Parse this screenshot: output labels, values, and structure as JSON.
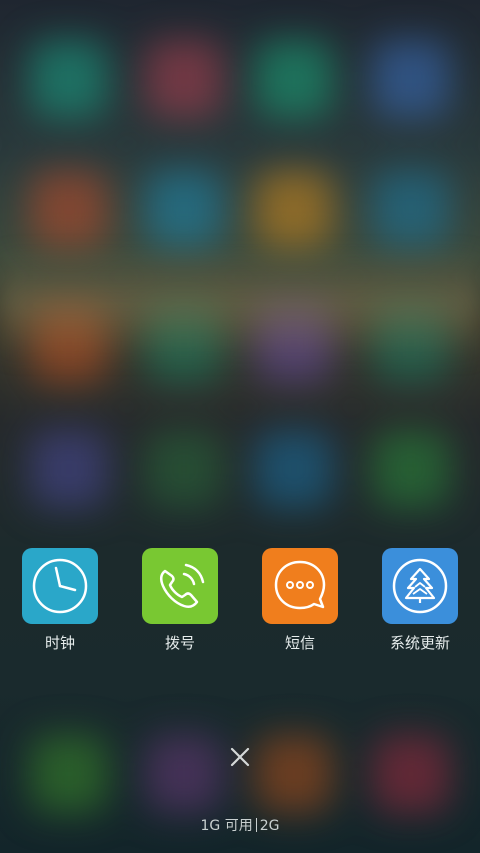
{
  "apps": [
    {
      "label": "时钟",
      "icon": "clock-icon",
      "color": "#2aa7c9"
    },
    {
      "label": "拨号",
      "icon": "phone-icon",
      "color": "#79c832"
    },
    {
      "label": "短信",
      "icon": "message-icon",
      "color": "#f07e1d"
    },
    {
      "label": "系统更新",
      "icon": "tree-update-icon",
      "color": "#3b8fdb"
    }
  ],
  "memory": {
    "available": "1G 可用",
    "total": "2G"
  },
  "close_icon": "close-icon"
}
